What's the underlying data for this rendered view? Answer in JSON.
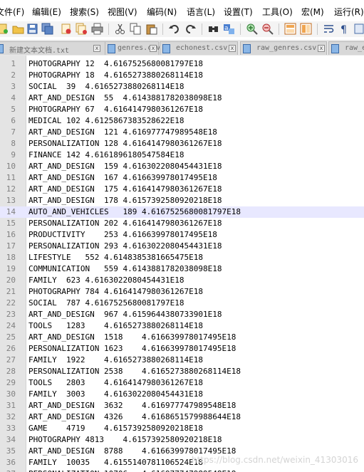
{
  "menu": [
    "文件(F)",
    "编辑(E)",
    "搜索(S)",
    "视图(V)",
    "编码(N)",
    "语言(L)",
    "设置(T)",
    "工具(O)",
    "宏(M)",
    "运行(R)"
  ],
  "tabs": [
    {
      "label": "新建文本文档.txt",
      "close": "x"
    },
    {
      "label": "genres.csv",
      "close": "x"
    },
    {
      "label": "echonest.csv",
      "close": "x"
    },
    {
      "label": "raw_genres.csv",
      "close": "x"
    },
    {
      "label": "raw_e",
      "close": "x"
    }
  ],
  "editor": {
    "current_line": 14,
    "lines": [
      {
        "num": "1",
        "text": "PHOTOGRAPHY 12  4.6167525680081797E18"
      },
      {
        "num": "2",
        "text": "PHOTOGRAPHY 18  4.6165273880268114E18"
      },
      {
        "num": "3",
        "text": "SOCIAL  39  4.6165273880268114E18"
      },
      {
        "num": "4",
        "text": "ART_AND_DESIGN  55  4.6143881782038098E18"
      },
      {
        "num": "5",
        "text": "PHOTOGRAPHY 67  4.6164147980361267E18"
      },
      {
        "num": "6",
        "text": "MEDICAL 102 4.6125867383528622E18"
      },
      {
        "num": "7",
        "text": "ART_AND_DESIGN  121 4.616977747989548E18"
      },
      {
        "num": "8",
        "text": "PERSONALIZATION 128 4.6164147980361267E18"
      },
      {
        "num": "9",
        "text": "FINANCE 142 4.6161896180547584E18"
      },
      {
        "num": "10",
        "text": "ART_AND_DESIGN  159 4.6163022080454431E18"
      },
      {
        "num": "11",
        "text": "ART_AND_DESIGN  167 4.616639978017495E18"
      },
      {
        "num": "12",
        "text": "ART_AND_DESIGN  175 4.6164147980361267E18"
      },
      {
        "num": "13",
        "text": "ART_AND_DESIGN  178 4.6157392580920218E18"
      },
      {
        "num": "14",
        "text": "AUTO_AND_VEHICLES   189 4.6167525680081797E18"
      },
      {
        "num": "15",
        "text": "PERSONALIZATION 202 4.6164147980361267E18"
      },
      {
        "num": "16",
        "text": "PRODUCTIVITY    253 4.616639978017495E18"
      },
      {
        "num": "17",
        "text": "PERSONALIZATION 293 4.6163022080454431E18"
      },
      {
        "num": "18",
        "text": "LIFESTYLE   552 4.6148385381665475E18"
      },
      {
        "num": "19",
        "text": "COMMUNICATION   559 4.6143881782038098E18"
      },
      {
        "num": "20",
        "text": "FAMILY  623 4.6163022080454431E18"
      },
      {
        "num": "21",
        "text": "PHOTOGRAPHY 784 4.6164147980361267E18"
      },
      {
        "num": "22",
        "text": "SOCIAL  787 4.6167525680081797E18"
      },
      {
        "num": "23",
        "text": "ART_AND_DESIGN  967 4.6159644380733901E18"
      },
      {
        "num": "24",
        "text": "TOOLS   1283    4.6165273880268114E18"
      },
      {
        "num": "25",
        "text": "ART_AND_DESIGN  1518    4.616639978017495E18"
      },
      {
        "num": "26",
        "text": "PERSONALIZATION 1623    4.616639978017495E18"
      },
      {
        "num": "27",
        "text": "FAMILY  1922    4.6165273880268114E18"
      },
      {
        "num": "28",
        "text": "PERSONALIZATION 2538    4.6165273880268114E18"
      },
      {
        "num": "29",
        "text": "TOOLS   2803    4.6164147980361267E18"
      },
      {
        "num": "30",
        "text": "FAMILY  3003    4.6163022080454431E18"
      },
      {
        "num": "31",
        "text": "ART_AND_DESIGN  3632    4.616977747989548E18"
      },
      {
        "num": "32",
        "text": "ART_AND_DESIGN  4326    4.6168651579988644E18"
      },
      {
        "num": "33",
        "text": "GAME    4719    4.6157392580920218E18"
      },
      {
        "num": "34",
        "text": "PHOTOGRAPHY 4813    4.6157392580920218E18"
      },
      {
        "num": "35",
        "text": "ART_AND_DESIGN  8788    4.616639978017495E18"
      },
      {
        "num": "36",
        "text": "FAMILY  10035   4.6155140781106524E18"
      },
      {
        "num": "37",
        "text": "PERSONALIZATION 10706   4.616977747989548E18"
      }
    ]
  },
  "watermark": "https://blog.csdn.net/weixin_41303016"
}
